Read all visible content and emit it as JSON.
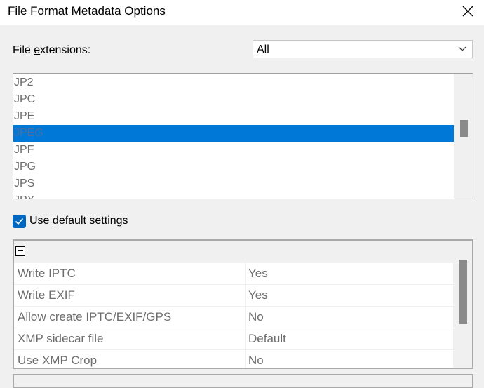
{
  "window": {
    "title": "File Format Metadata Options"
  },
  "extensions": {
    "label_pre": "File ",
    "label_u": "e",
    "label_post": "xtensions:",
    "selected": "All"
  },
  "list": {
    "items": [
      "JP2",
      "JPC",
      "JPE",
      "JPEG",
      "JPF",
      "JPG",
      "JPS",
      "JPX"
    ],
    "selected_index": 3
  },
  "default_settings": {
    "label_pre": "Use ",
    "label_u": "d",
    "label_post": "efault settings",
    "checked": true
  },
  "properties": {
    "rows": [
      {
        "name": "Write IPTC",
        "value": "Yes"
      },
      {
        "name": "Write EXIF",
        "value": "Yes"
      },
      {
        "name": "Allow create IPTC/EXIF/GPS",
        "value": "No"
      },
      {
        "name": "XMP sidecar file",
        "value": "Default"
      },
      {
        "name": "Use XMP Crop",
        "value": "No"
      }
    ]
  },
  "colors": {
    "selection": "#0078d7",
    "checkbox": "#0067c0"
  }
}
